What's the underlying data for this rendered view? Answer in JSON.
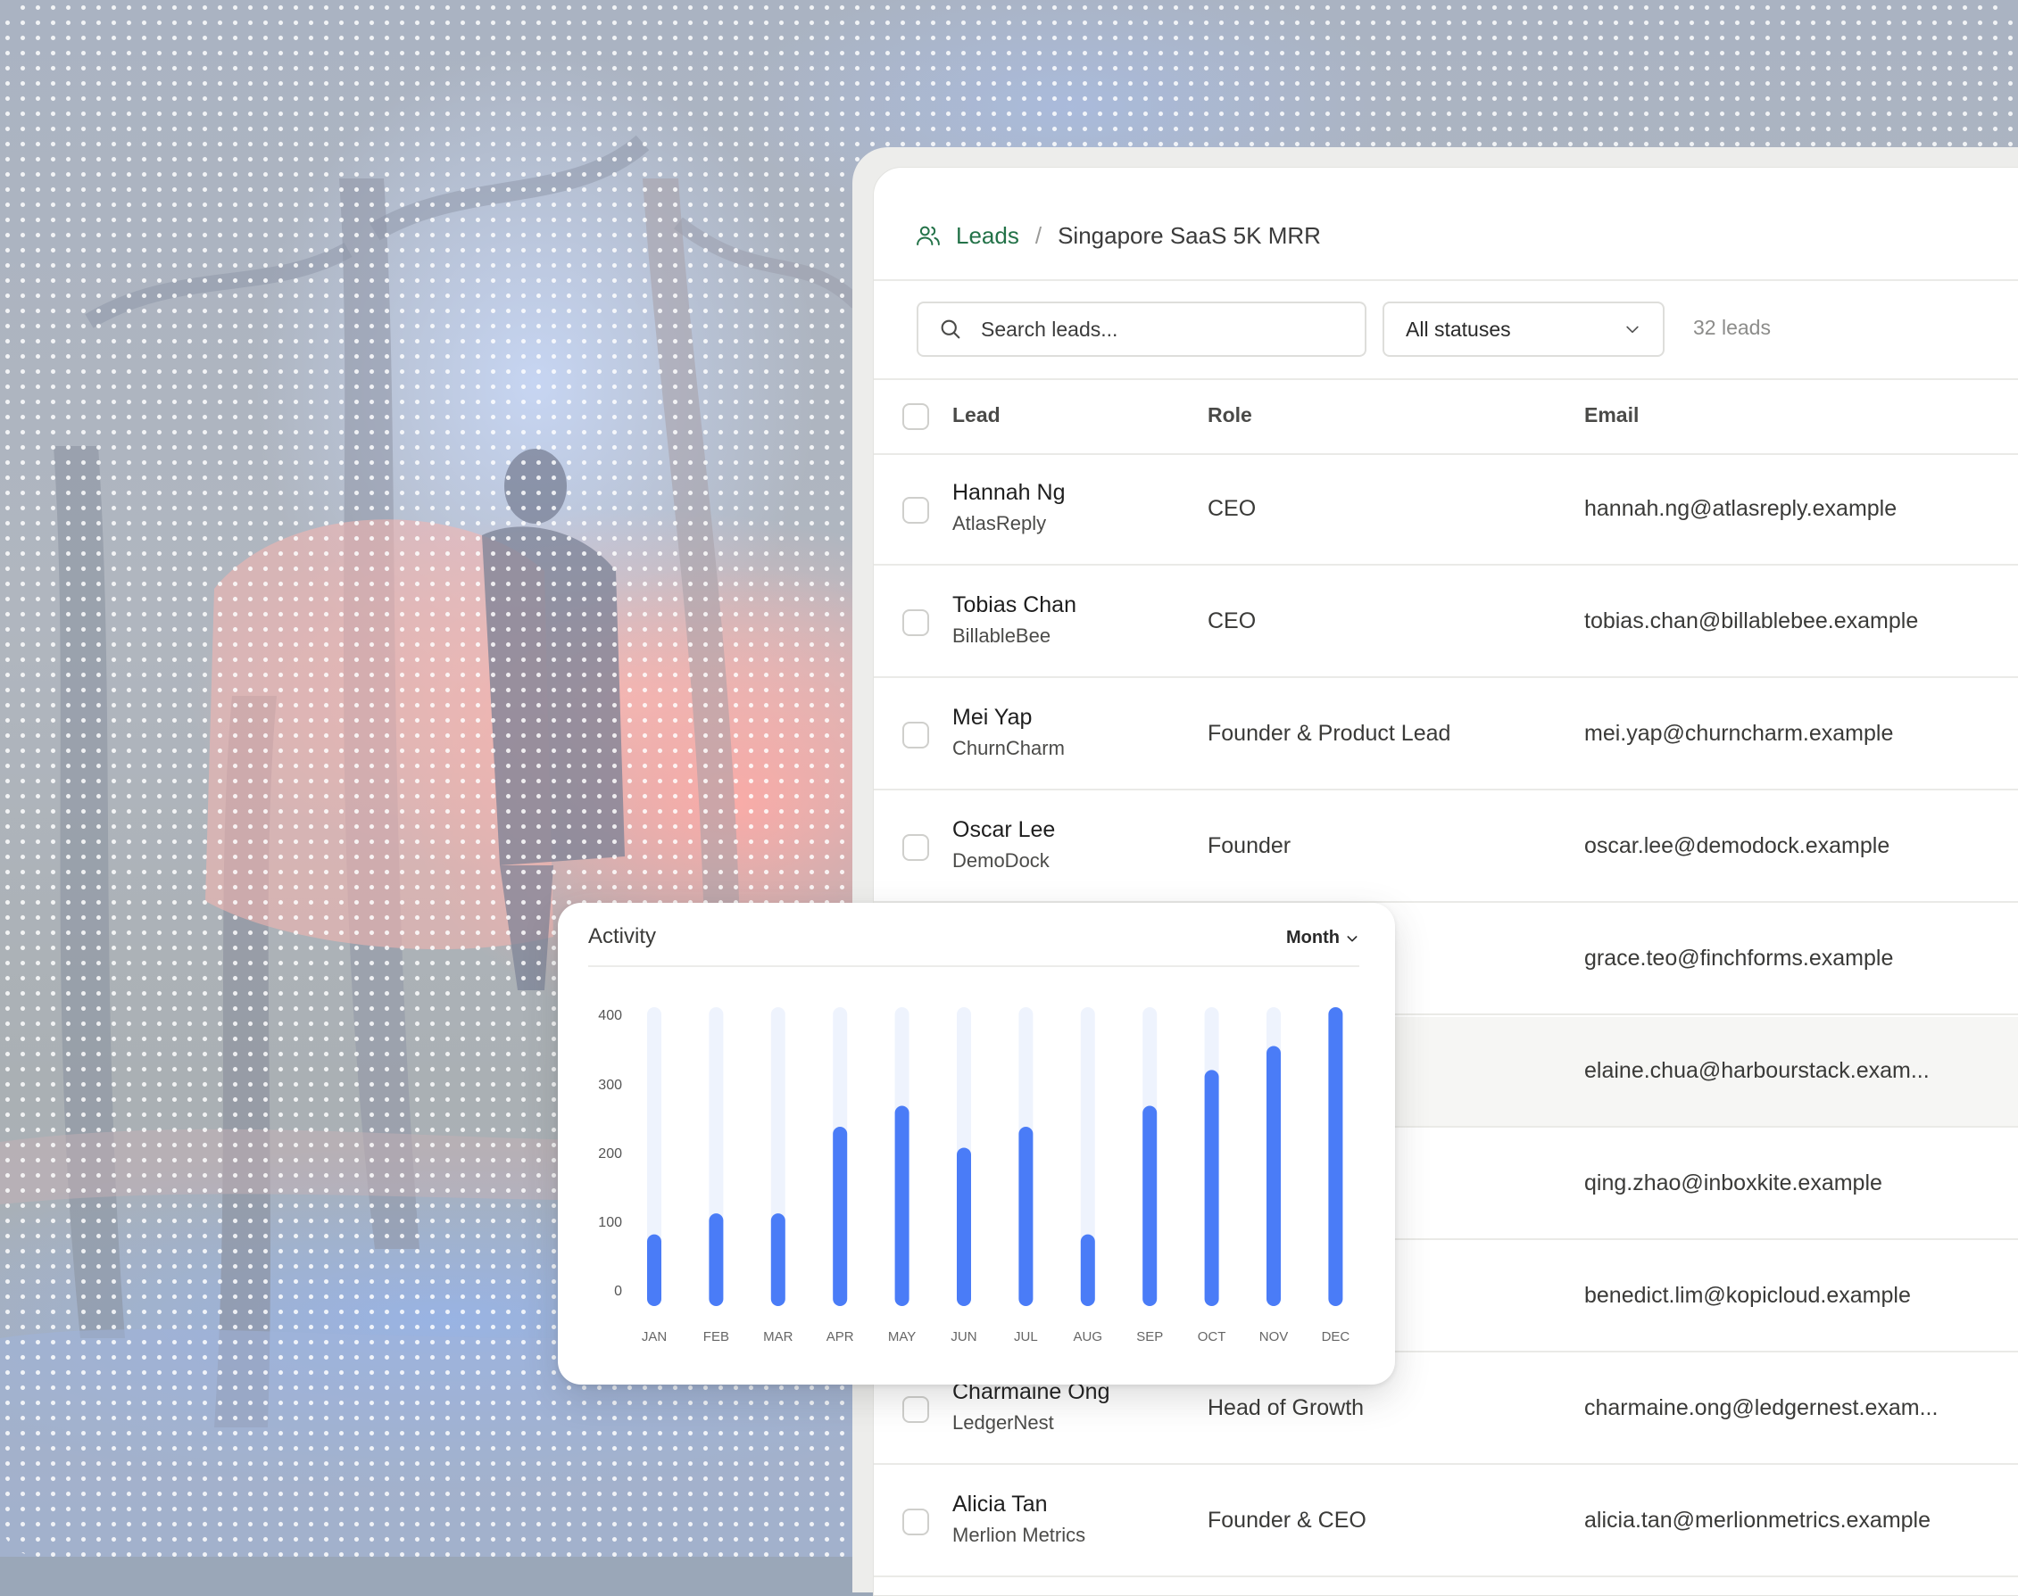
{
  "breadcrumb": {
    "icon": "users-icon",
    "root": "Leads",
    "separator": "/",
    "current": "Singapore SaaS 5K MRR"
  },
  "toolbar": {
    "search_placeholder": "Search leads...",
    "status_filter": "All statuses",
    "lead_count": "32 leads"
  },
  "table": {
    "columns": [
      "Lead",
      "Role",
      "Email"
    ],
    "rows": [
      {
        "name": "Hannah Ng",
        "company": "AtlasReply",
        "role": "CEO",
        "email": "hannah.ng@atlasreply.example"
      },
      {
        "name": "Tobias Chan",
        "company": "BillableBee",
        "role": "CEO",
        "email": "tobias.chan@billablebee.example"
      },
      {
        "name": "Mei Yap",
        "company": "ChurnCharm",
        "role": "Founder & Product Lead",
        "email": "mei.yap@churncharm.example"
      },
      {
        "name": "Oscar Lee",
        "company": "DemoDock",
        "role": "Founder",
        "email": "oscar.lee@demodock.example"
      },
      {
        "name": "",
        "company": "",
        "role": "",
        "email": "grace.teo@finchforms.example"
      },
      {
        "name": "",
        "company": "",
        "role": "",
        "email": "elaine.chua@harbourstack.exam..."
      },
      {
        "name": "",
        "company": "",
        "role": "",
        "email": "qing.zhao@inboxkite.example"
      },
      {
        "name": "",
        "company": "",
        "role": "",
        "email": "benedict.lim@kopicloud.example"
      },
      {
        "name": "Charmaine Ong",
        "company": "LedgerNest",
        "role": "Head of Growth",
        "email": "charmaine.ong@ledgernest.exam..."
      },
      {
        "name": "Alicia Tan",
        "company": "Merlion Metrics",
        "role": "Founder & CEO",
        "email": "alicia.tan@merlionmetrics.example"
      }
    ]
  },
  "activity": {
    "title": "Activity",
    "period": "Month"
  },
  "chart_data": {
    "type": "bar",
    "title": "Activity",
    "categories": [
      "JAN",
      "FEB",
      "MAR",
      "APR",
      "MAY",
      "JUN",
      "JUL",
      "AUG",
      "SEP",
      "OCT",
      "NOV",
      "DEC"
    ],
    "values": [
      120,
      155,
      155,
      300,
      335,
      265,
      300,
      120,
      335,
      395,
      435,
      500
    ],
    "y_ticks": [
      0,
      100,
      200,
      300,
      400
    ],
    "ylim": [
      0,
      500
    ],
    "grid": false,
    "bar_color": "#4a7cf7",
    "track_color": "#eef3fd"
  },
  "colors": {
    "accent_green": "#237248"
  }
}
